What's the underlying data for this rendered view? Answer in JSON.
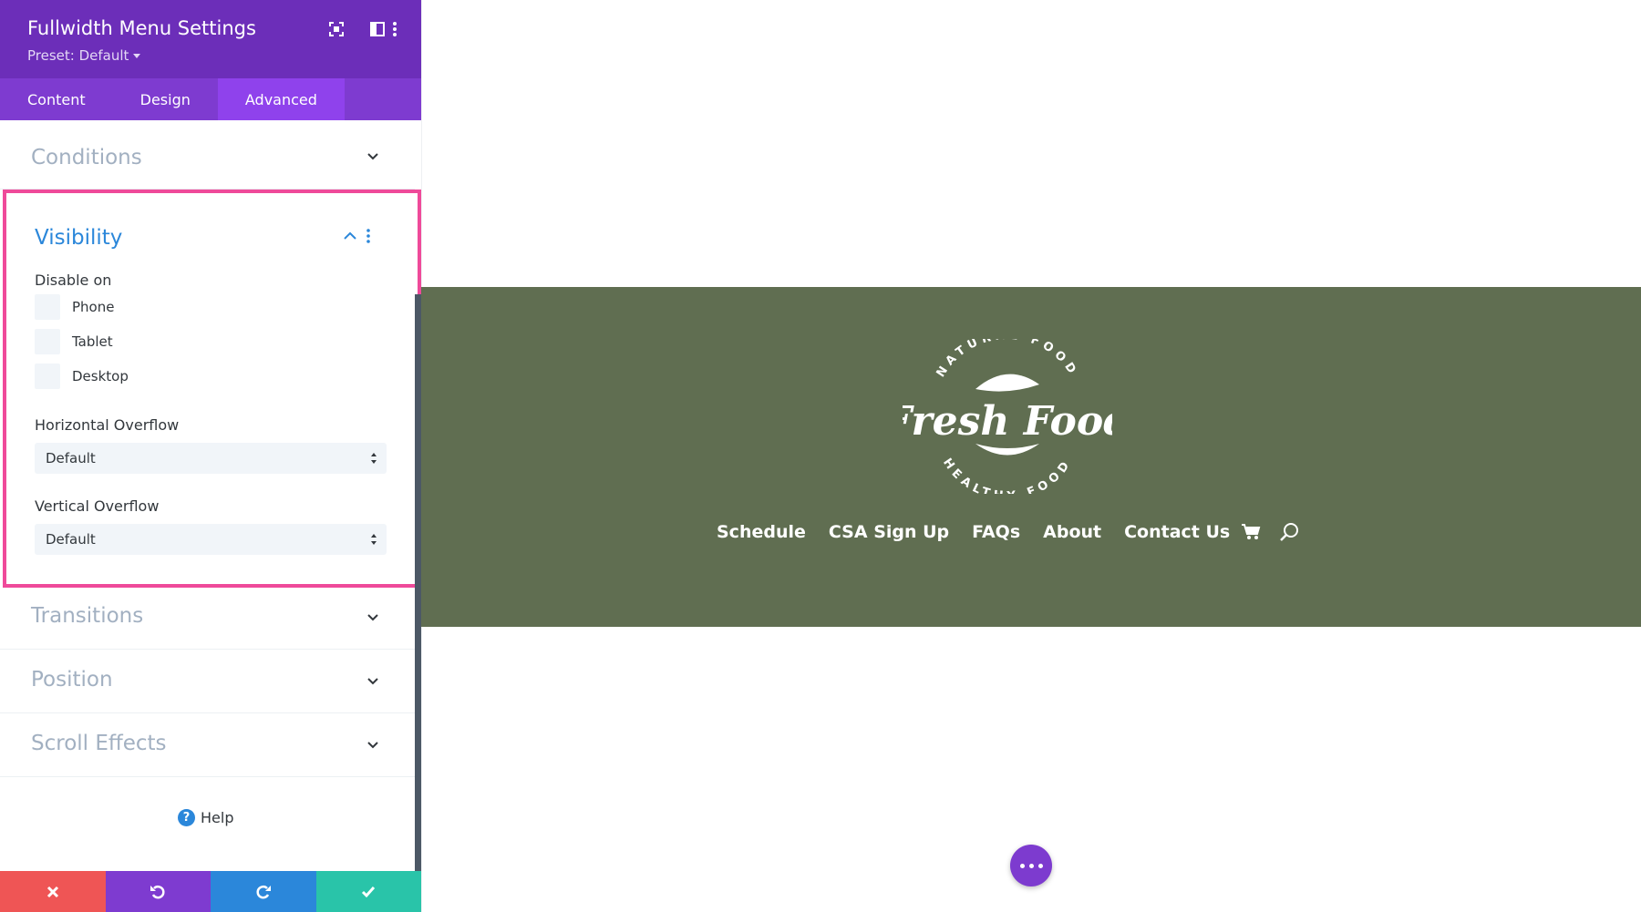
{
  "panel": {
    "title": "Fullwidth Menu Settings",
    "preset": "Preset: Default",
    "tabs": [
      {
        "label": "Content"
      },
      {
        "label": "Design"
      },
      {
        "label": "Advanced"
      }
    ],
    "active_tab": "Advanced",
    "sections": {
      "conditions": "Conditions",
      "visibility": "Visibility",
      "transitions": "Transitions",
      "position": "Position",
      "scroll_effects": "Scroll Effects"
    },
    "visibility": {
      "disable_on_label": "Disable on",
      "devices": [
        {
          "label": "Phone",
          "checked": false
        },
        {
          "label": "Tablet",
          "checked": false
        },
        {
          "label": "Desktop",
          "checked": false
        }
      ],
      "horizontal_overflow": {
        "label": "Horizontal Overflow",
        "value": "Default"
      },
      "vertical_overflow": {
        "label": "Vertical Overflow",
        "value": "Default"
      }
    },
    "help_label": "Help",
    "footer_colors": {
      "discard": "#ef5555",
      "undo": "#7e3bd0",
      "redo": "#2b87da",
      "save": "#29c4a9"
    }
  },
  "preview": {
    "band_color": "#606e51",
    "logo": {
      "top_arc": "NATURAL FOOD",
      "wordmark": "Fresh Food",
      "bottom_arc": "HEALTHY FOOD"
    },
    "menu": [
      "Schedule",
      "CSA Sign Up",
      "FAQs",
      "About",
      "Contact Us"
    ]
  },
  "accent": {
    "purple": "#6c2eb9",
    "highlight": "#ef4a9a",
    "link_blue": "#2b87da"
  }
}
